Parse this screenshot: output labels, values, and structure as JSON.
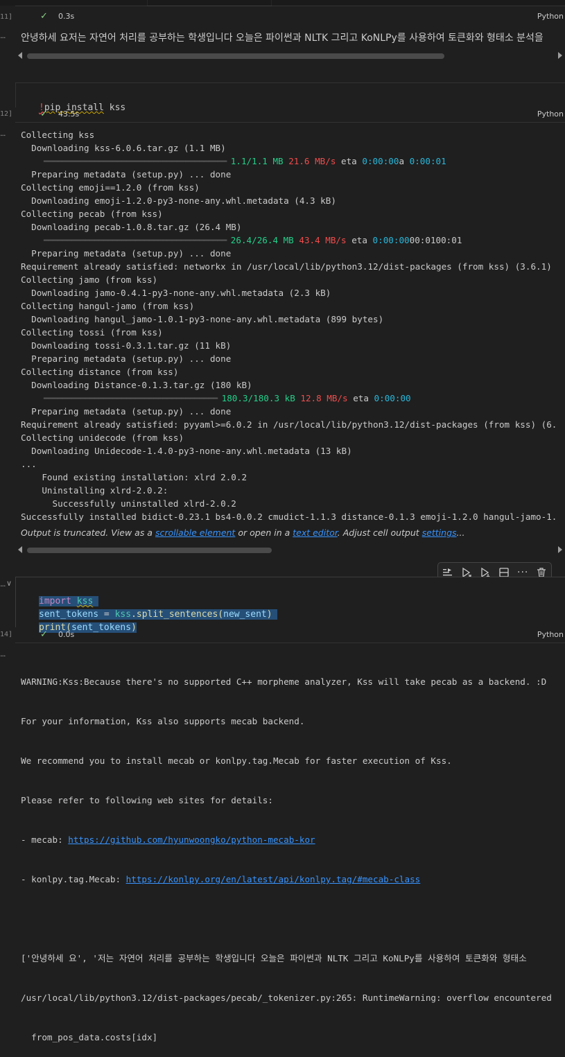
{
  "gutter": {
    "cell1": "11]",
    "cell2": "12]",
    "cell3": "14]",
    "dots": "...",
    "arrow": "∨"
  },
  "cells": {
    "top": {
      "time": "0.3s",
      "lang": "Python"
    },
    "markdown_text": "안녕하세 요저는 자연어 처리를 공부하는 학생입니다 오늘은 파이썬과 NLTK 그리고 KoNLPy를 사용하여 토큰화와 형태소 분석을",
    "pip": {
      "bang": "!",
      "cmd": "pip install",
      "arg": "kss",
      "time": "43.5s",
      "lang": "Python"
    },
    "kss": {
      "line1": {
        "kw": "import",
        "mod": "kss"
      },
      "line2": {
        "var": "sent_tokens",
        "op": " = ",
        "mod": "kss",
        "fn": ".split_sentences(",
        "arg": "new_sent",
        "close": ")"
      },
      "line3": {
        "fn": "print(",
        "arg": "sent_tokens",
        "close": ")"
      },
      "time": "0.0s",
      "lang": "Python"
    }
  },
  "pip_output": [
    "Collecting kss",
    "  Downloading kss-6.0.6.tar.gz (1.1 MB)",
    {
      "bar": "     ━━━━━━━━━━━━━━━━━━━━━━━━━━━━━━━━━━━━━━━━ ",
      "size": "1.1/1.1 MB",
      "speed": "21.6 MB/s",
      "eta": " eta ",
      "etaval": "0:00:00",
      "tail": "a ",
      "tail2": "0:00:01"
    },
    "  Preparing metadata (setup.py) ... done",
    "Collecting emoji==1.2.0 (from kss)",
    "  Downloading emoji-1.2.0-py3-none-any.whl.metadata (4.3 kB)",
    "Collecting pecab (from kss)",
    "  Downloading pecab-1.0.8.tar.gz (26.4 MB)",
    {
      "bar": "     ━━━━━━━━━━━━━━━━━━━━━━━━━━━━━━━━━━━━━━━━ ",
      "size": "26.4/26.4 MB",
      "speed": "43.4 MB/s",
      "eta": " eta ",
      "etaval": "0:00:00",
      "tail": "00:0100:01",
      "tail2": ""
    },
    "  Preparing metadata (setup.py) ... done",
    "Requirement already satisfied: networkx in /usr/local/lib/python3.12/dist-packages (from kss) (3.6.1)",
    "Collecting jamo (from kss)",
    "  Downloading jamo-0.4.1-py3-none-any.whl.metadata (2.3 kB)",
    "Collecting hangul-jamo (from kss)",
    "  Downloading hangul_jamo-1.0.1-py3-none-any.whl.metadata (899 bytes)",
    "Collecting tossi (from kss)",
    "  Downloading tossi-0.3.1.tar.gz (11 kB)",
    "  Preparing metadata (setup.py) ... done",
    "Collecting distance (from kss)",
    "  Downloading Distance-0.1.3.tar.gz (180 kB)",
    {
      "bar": "     ━━━━━━━━━━━━━━━━━━━━━━━━━━━━━━━━━━━━━━ ",
      "size": "180.3/180.3 kB",
      "speed": "12.8 MB/s",
      "eta": " eta ",
      "etaval": "0:00:00",
      "tail": "",
      "tail2": ""
    },
    "  Preparing metadata (setup.py) ... done",
    "Requirement already satisfied: pyyaml>=6.0.2 in /usr/local/lib/python3.12/dist-packages (from kss) (6.",
    "Collecting unidecode (from kss)",
    "  Downloading Unidecode-1.4.0-py3-none-any.whl.metadata (13 kB)",
    "...",
    "    Found existing installation: xlrd 2.0.2",
    "    Uninstalling xlrd-2.0.2:",
    "      Successfully uninstalled xlrd-2.0.2",
    "Successfully installed bidict-0.23.1 bs4-0.0.2 cmudict-1.1.3 distance-0.1.3 emoji-1.2.0 hangul-jamo-1."
  ],
  "truncation": {
    "prefix": "Output is truncated. View as a ",
    "link1": "scrollable element",
    "mid1": " or open in a ",
    "link2": "text editor",
    "mid2": ". Adjust cell output ",
    "link3": "settings",
    "suffix": "..."
  },
  "kss_output": {
    "line1": "WARNING:Kss:Because there's no supported C++ morpheme analyzer, Kss will take pecab as a backend. :D",
    "line2": "For your information, Kss also supports mecab backend.",
    "line3": "We recommend you to install mecab or konlpy.tag.Mecab for faster execution of Kss.",
    "line4": "Please refer to following web sites for details:",
    "line5_prefix": "- mecab: ",
    "line5_link": "https://github.com/hyunwoongko/python-mecab-kor",
    "line6_prefix": "- konlpy.tag.Mecab: ",
    "line6_link": "https://konlpy.org/en/latest/api/konlpy.tag/#mecab-class",
    "line7": "['안녕하세 요', '저는 자연어 처리를 공부하는 학생입니다 오늘은 파이썬과 NLTK 그리고 KoNLPy를 사용하여 토큰화와 형태소",
    "line8": "/usr/local/lib/python3.12/dist-packages/pecab/_tokenizer.py:265: RuntimeWarning: overflow encountered",
    "line9": "  from_pos_data.costs[idx]"
  },
  "colors": {
    "background": "#1f1f1f",
    "success": "#89d185",
    "link": "#3794ff",
    "progress_green": "#23d18b",
    "progress_red": "#f14c4c",
    "progress_cyan": "#29b8db"
  },
  "toolbar_icons": [
    "run-by-line-icon",
    "execute-above-icon",
    "execute-below-icon",
    "split-cell-icon",
    "more-icon",
    "delete-icon"
  ]
}
